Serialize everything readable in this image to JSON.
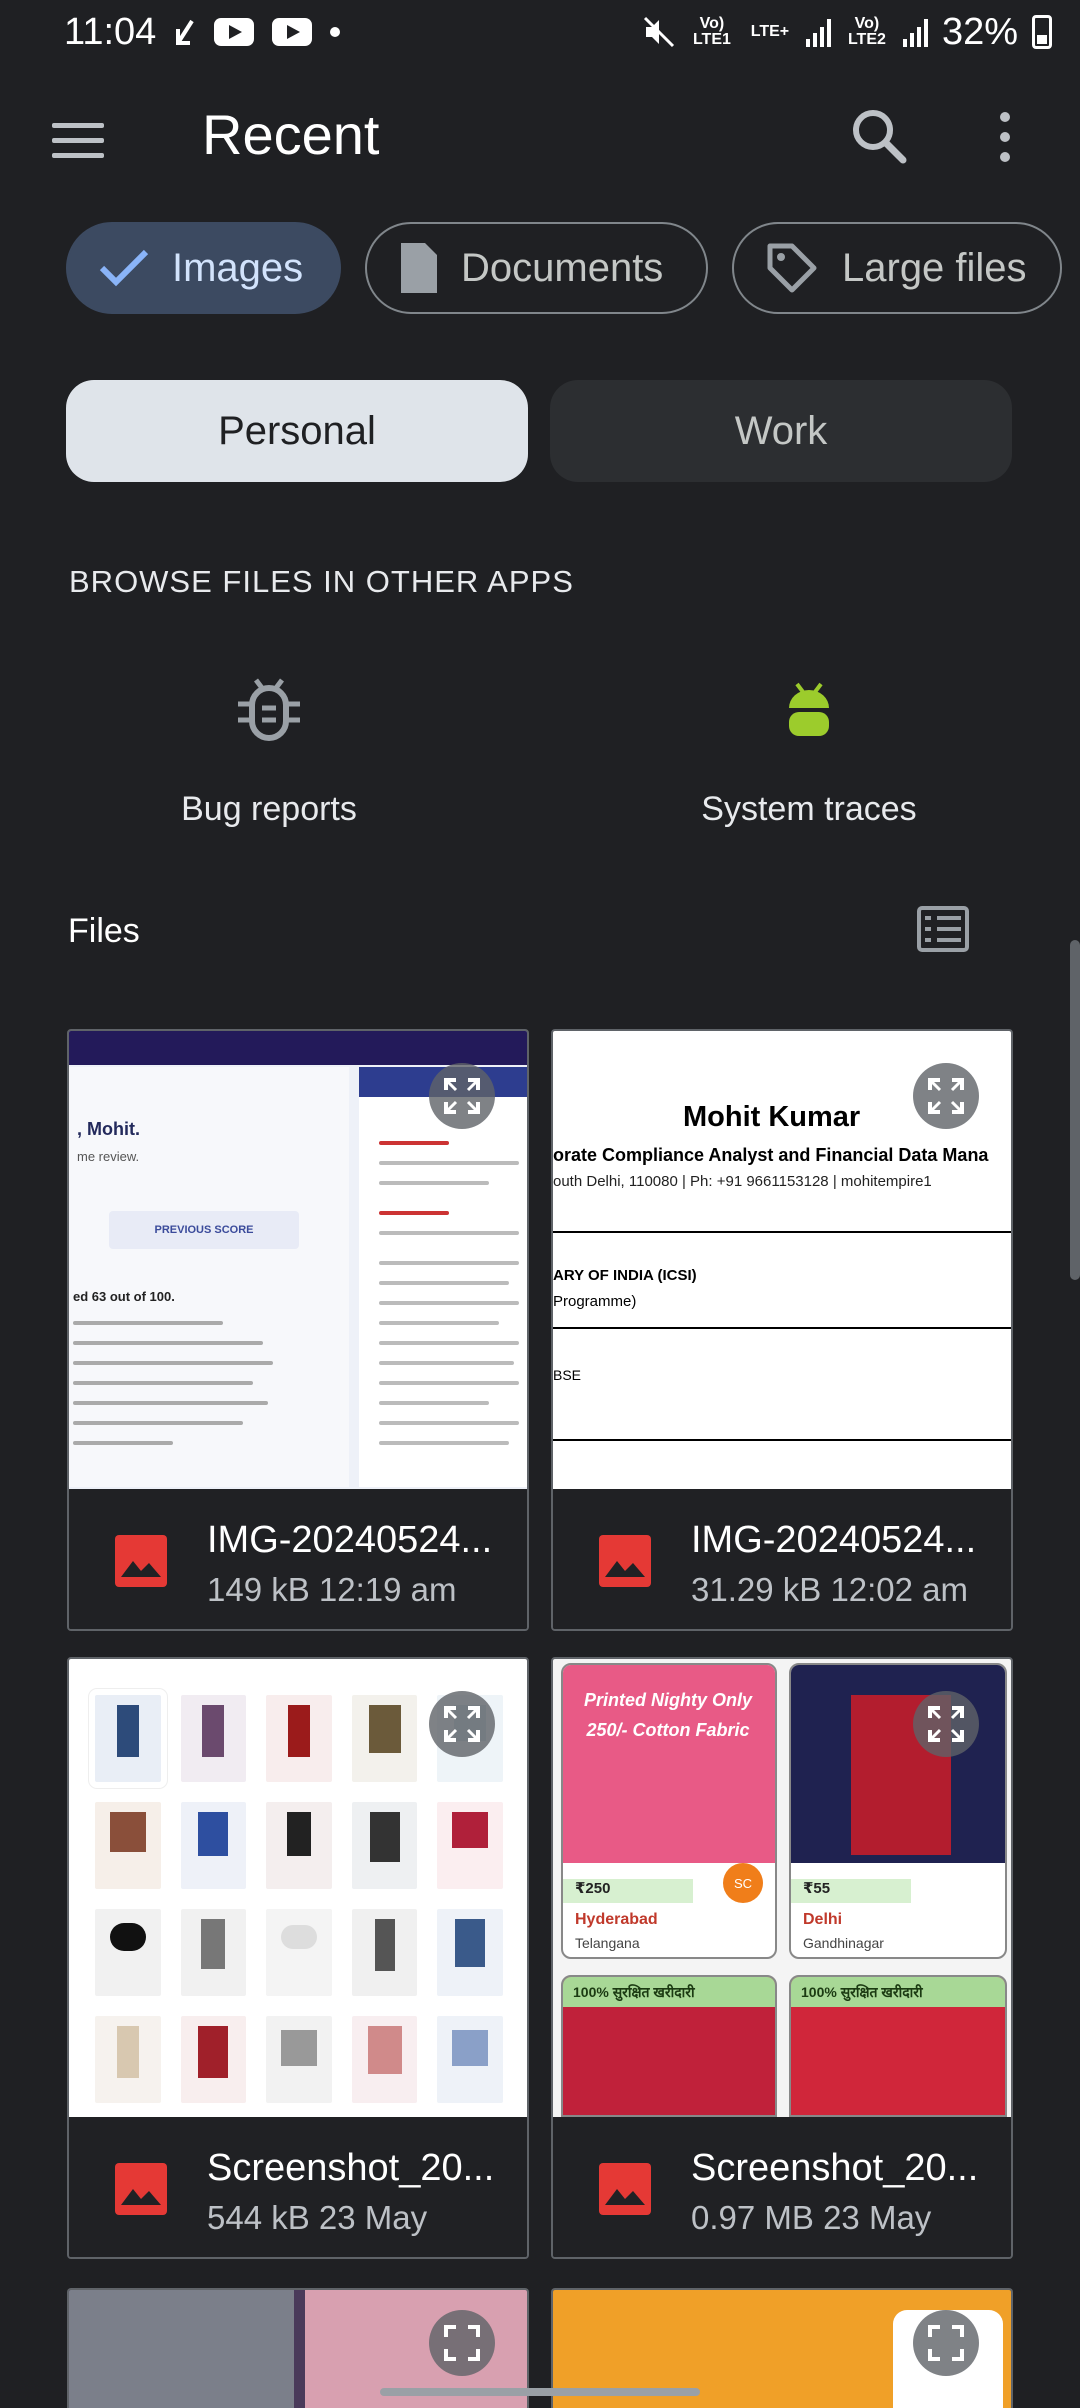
{
  "status_bar": {
    "time": "11:04",
    "net1": "Vo) LTE1",
    "net_lte": "LTE+",
    "net2": "Vo) LTE2",
    "battery": "32%"
  },
  "app_bar": {
    "title": "Recent"
  },
  "chips": [
    {
      "label": "Images",
      "selected": true
    },
    {
      "label": "Documents",
      "selected": false
    },
    {
      "label": "Large files",
      "selected": false
    }
  ],
  "segments": {
    "personal": "Personal",
    "work": "Work",
    "active": "Personal"
  },
  "browse": {
    "title": "BROWSE FILES IN OTHER APPS",
    "apps": [
      {
        "label": "Bug reports",
        "icon": "bug-icon"
      },
      {
        "label": "System traces",
        "icon": "system-traces-icon"
      }
    ]
  },
  "files": {
    "title": "Files",
    "items": [
      {
        "name": "IMG-20240524...",
        "size": "149 kB",
        "time": "12:19 am"
      },
      {
        "name": "IMG-20240524...",
        "size": "31.29 kB",
        "time": "12:02 am"
      },
      {
        "name": "Screenshot_20...",
        "size": "544 kB",
        "time": "23 May"
      },
      {
        "name": "Screenshot_20...",
        "size": "0.97 MB",
        "time": "23 May"
      }
    ]
  },
  "thumb_text": {
    "resume_name": "Mohit Kumar",
    "resume_role": "orate Compliance Analyst and Financial Data Mana",
    "resume_contact": "outh Delhi, 110080 | Ph: +91 9661153128 | mohitempire1",
    "resume_line1": "ARY OF INDIA (ICSI)",
    "resume_line2": "Programme)",
    "resume_line3": "BSE",
    "score_hello": ", Mohit.",
    "score_review": "me review.",
    "score_button": "PREVIOUS SCORE",
    "score_result": "ed 63 out of 100.",
    "shop_price1": "₹250",
    "shop_city1": "Hyderabad",
    "shop_state1": "Telangana",
    "shop_price2": "₹55",
    "shop_city2": "Delhi",
    "shop_state2": "Gandhinagar",
    "shop_badge": "100% सुरक्षित खरीदारी",
    "nighty": "Printed Nighty Only 250/- Cotton Fabric"
  },
  "colors": {
    "background": "#1f2023",
    "chip_selected": "#3c4a61",
    "accent_green": "#9ccc2c",
    "image_red": "#e53935"
  }
}
